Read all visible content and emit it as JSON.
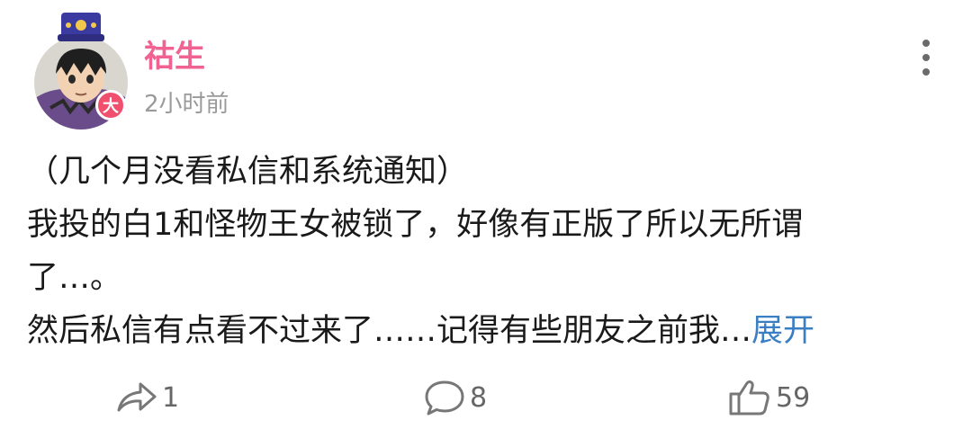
{
  "user": {
    "name": "祜生",
    "timestamp": "2小时前",
    "badge_label": "大",
    "avatar_icon": "anime-character-avatar",
    "badge_color": "#f0506e",
    "name_color": "#f06292"
  },
  "post": {
    "lines": [
      "（几个月没看私信和系统通知）",
      "我投的白1和怪物王女被锁了，好像有正版了所以无所谓",
      "了…。",
      "然后私信有点看不过来了……记得有些朋友之前我…"
    ],
    "expand_label": "展开",
    "expand_color": "#3a7fc4"
  },
  "actions": {
    "share": {
      "icon": "share-icon",
      "count": "1"
    },
    "comment": {
      "icon": "comment-icon",
      "count": "8"
    },
    "like": {
      "icon": "thumbs-up-icon",
      "count": "59"
    }
  },
  "menu": {
    "icon": "more-vertical-icon"
  }
}
